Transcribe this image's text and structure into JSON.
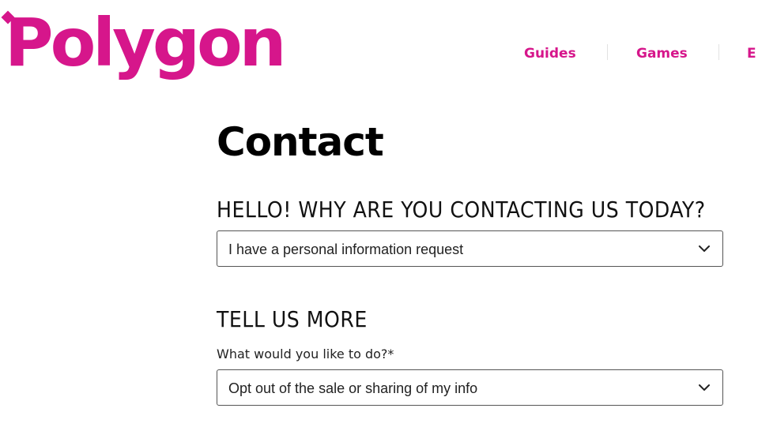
{
  "header": {
    "logo_text": "Polygon",
    "nav": [
      {
        "label": "Guides"
      },
      {
        "label": "Games"
      },
      {
        "label": "E"
      }
    ]
  },
  "main": {
    "title": "Contact",
    "reason_heading": "HELLO! WHY ARE YOU CONTACTING US TODAY?",
    "reason_select": {
      "value": "I have a personal information request",
      "icon": "chevron-down-icon"
    },
    "more_heading": "TELL US MORE",
    "action_label": "What would you like to do?*",
    "action_select": {
      "value": "Opt out of the sale or sharing of my info",
      "icon": "chevron-down-icon"
    }
  },
  "colors": {
    "brand": "#d6168b",
    "text": "#111111",
    "border": "#555555"
  }
}
